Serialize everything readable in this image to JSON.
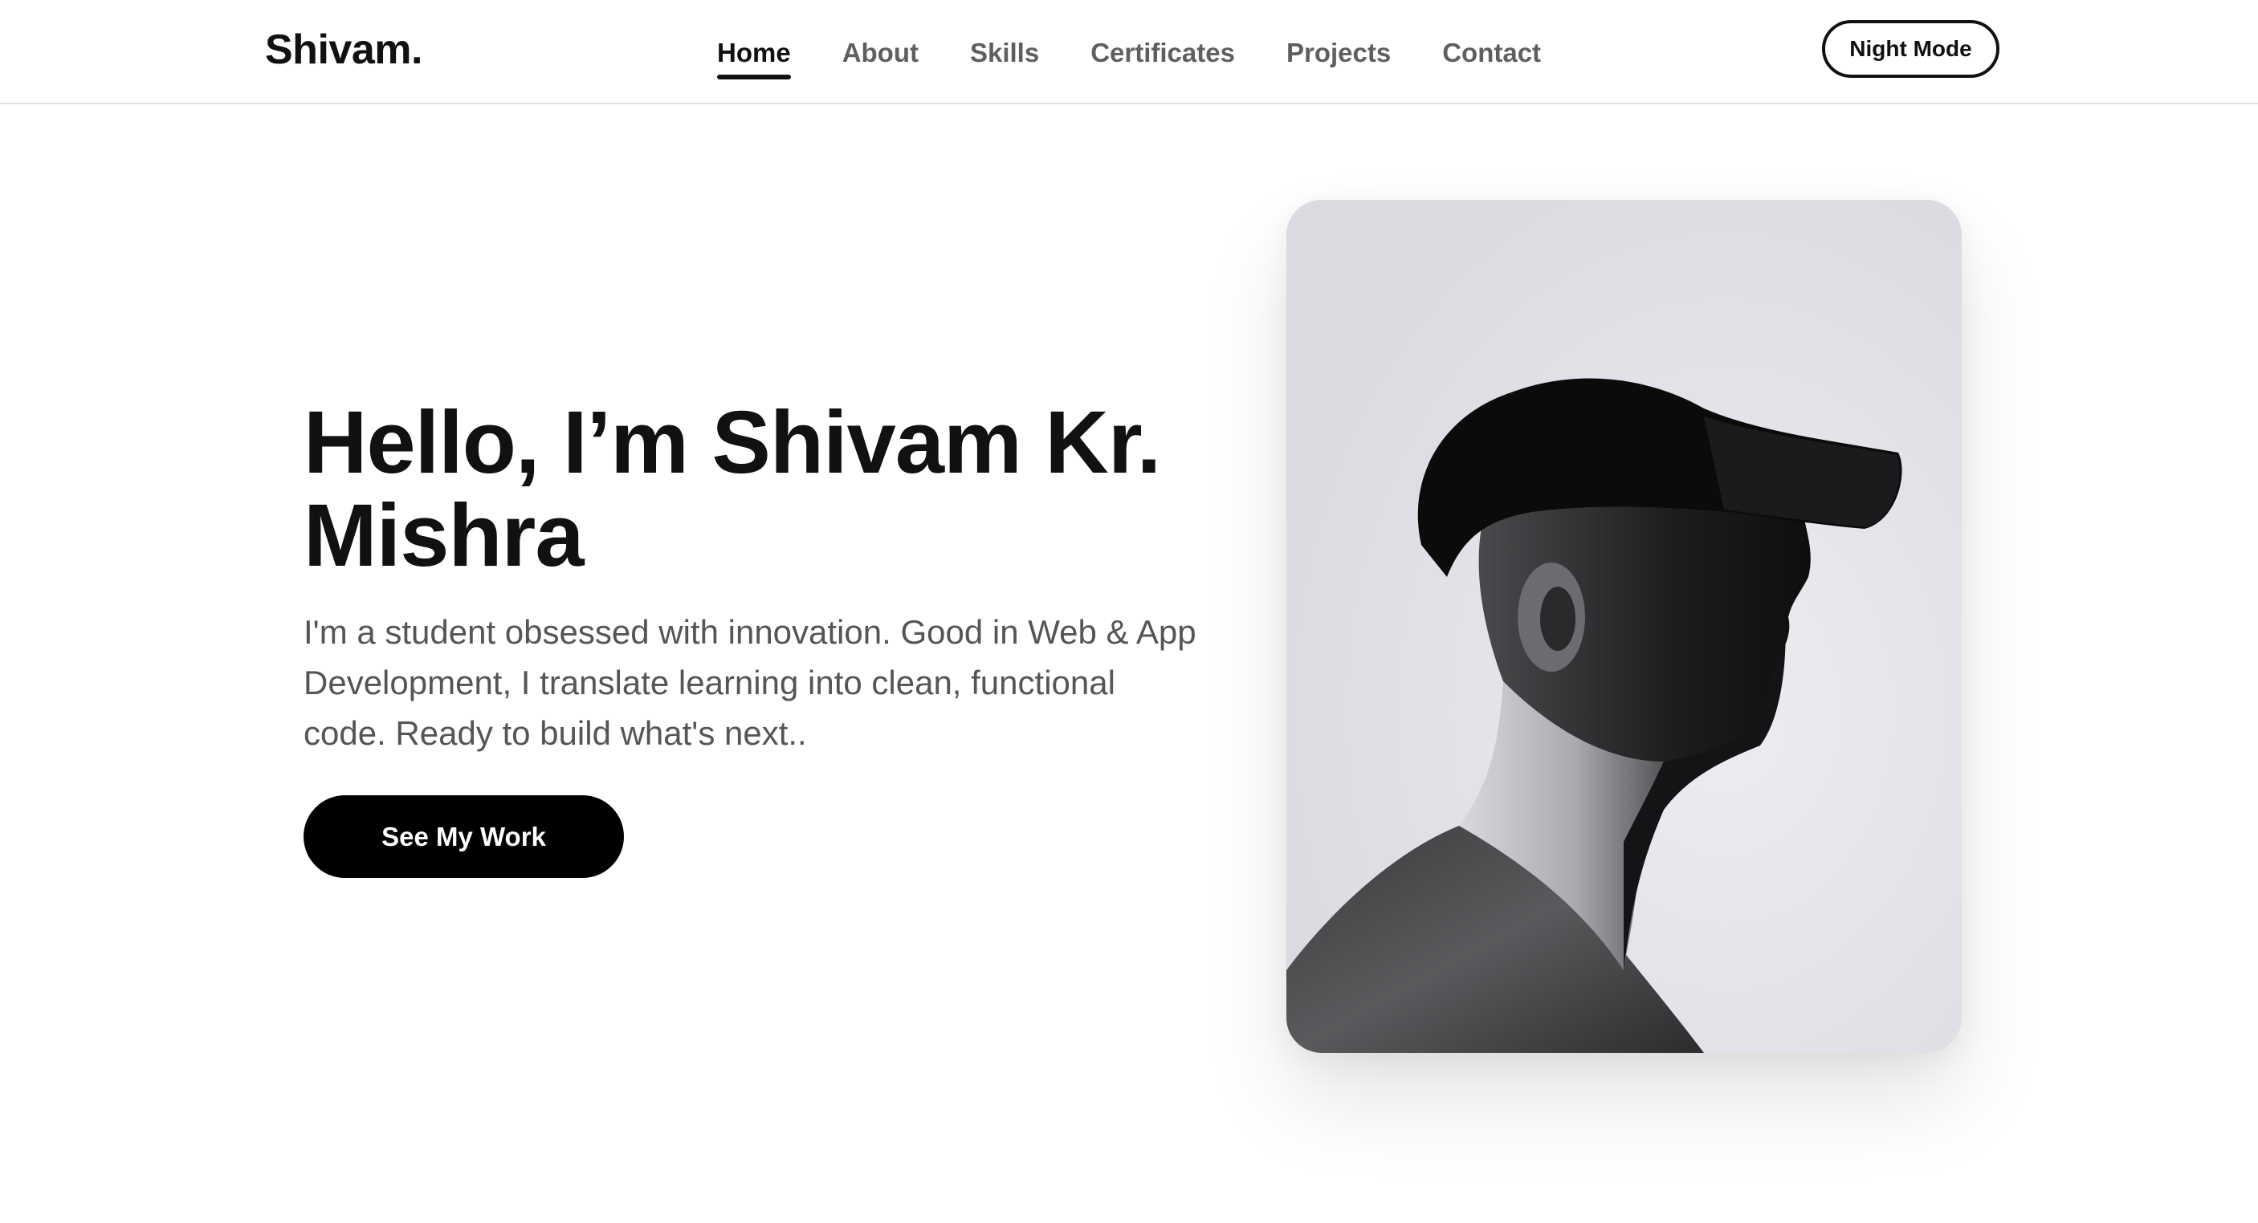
{
  "header": {
    "logo": "Shivam.",
    "nav": [
      {
        "label": "Home",
        "active": true
      },
      {
        "label": "About",
        "active": false
      },
      {
        "label": "Skills",
        "active": false
      },
      {
        "label": "Certificates",
        "active": false
      },
      {
        "label": "Projects",
        "active": false
      },
      {
        "label": "Contact",
        "active": false
      }
    ],
    "theme_toggle_label": "Night Mode"
  },
  "hero": {
    "title": "Hello, I’m Shivam Kr. Mishra",
    "description": "I'm a student obsessed with innovation. Good in Web & App Development, I translate learning into clean, functional code. Ready to build what's next..",
    "cta_label": "See My Work"
  },
  "portrait": {
    "subject": "black-and-white side profile photo of a person wearing a cap"
  },
  "colors": {
    "text_primary": "#111111",
    "text_muted": "#555555",
    "nav_inactive": "#5f5f5f",
    "button_bg": "#000000",
    "button_text": "#ffffff",
    "background": "#ffffff"
  }
}
